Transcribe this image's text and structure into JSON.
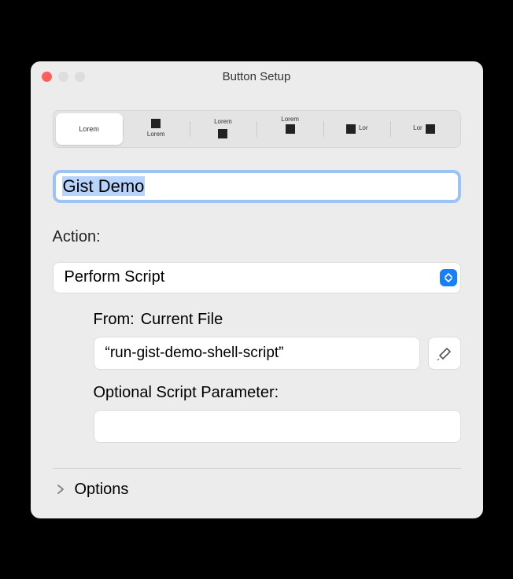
{
  "window": {
    "title": "Button Setup"
  },
  "tabs": [
    {
      "label": "Lorem"
    },
    {
      "label": "Lorem"
    },
    {
      "label": "Lorem"
    },
    {
      "label": "Lorem"
    },
    {
      "label": "Lor"
    },
    {
      "label": "Lor"
    }
  ],
  "name_field": {
    "value": "Gist Demo"
  },
  "action": {
    "label": "Action:",
    "value": "Perform Script"
  },
  "script": {
    "from_label": "From:",
    "from_value": "Current File",
    "script_name": "“run-gist-demo-shell-script”",
    "param_label": "Optional Script Parameter:",
    "param_value": ""
  },
  "options": {
    "label": "Options"
  }
}
